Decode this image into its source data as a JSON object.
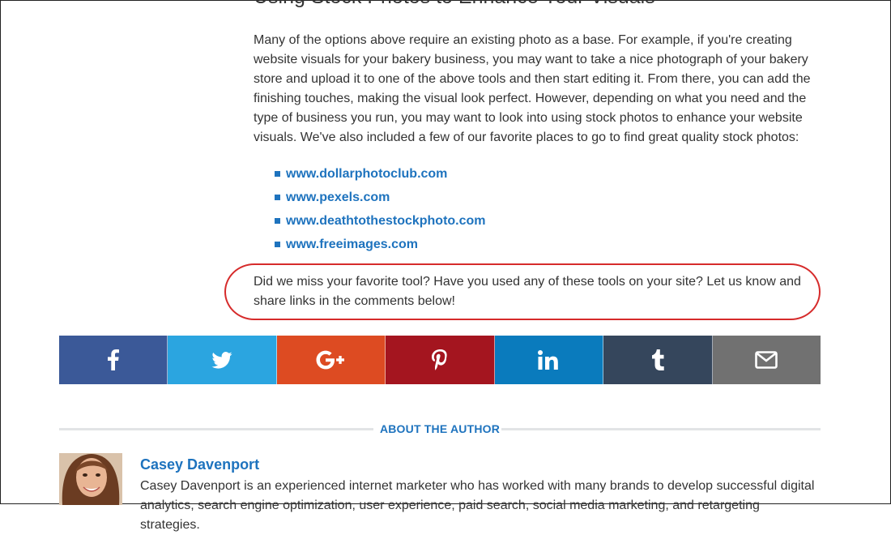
{
  "article": {
    "section_heading": "Using Stock Photos to Enhance Your Visuals",
    "paragraph": "Many of the options above require an existing photo as a base. For example, if you're creating website visuals for your bakery business, you may want to take a nice photograph of your bakery store and upload it to one of the above tools and then start editing it. From there, you can add the finishing touches, making the visual look perfect. However, depending on what you need and the type of business you run, you may want to look into using stock photos to enhance your website visuals. We've also included a few of our favorite places to go to find great quality stock photos:",
    "links": [
      {
        "label": "www.dollarphotoclub.com"
      },
      {
        "label": "www.pexels.com"
      },
      {
        "label": "www.deathtothestockphoto.com"
      },
      {
        "label": "www.freeimages.com"
      }
    ],
    "closing": "Did we miss your favorite tool? Have you used any of these tools on your site? Let us know and share links in the comments below!"
  },
  "share_bar": [
    {
      "network": "facebook",
      "icon": "facebook-icon",
      "color": "#3b5998"
    },
    {
      "network": "twitter",
      "icon": "twitter-icon",
      "color": "#2ba5e0"
    },
    {
      "network": "google-plus",
      "icon": "google-plus-icon",
      "color": "#dd4b22"
    },
    {
      "network": "pinterest",
      "icon": "pinterest-icon",
      "color": "#a4151f"
    },
    {
      "network": "linkedin",
      "icon": "linkedin-icon",
      "color": "#0a7bbd"
    },
    {
      "network": "tumblr",
      "icon": "tumblr-icon",
      "color": "#35465c"
    },
    {
      "network": "email",
      "icon": "envelope-icon",
      "color": "#717171"
    }
  ],
  "about": {
    "label": "ABOUT THE AUTHOR"
  },
  "author": {
    "name": "Casey Davenport",
    "bio": "Casey Davenport is an experienced internet marketer who has worked with many brands to develop successful digital analytics, search engine optimization, user experience, paid search, social media marketing, and retargeting strategies."
  },
  "colors": {
    "link": "#1e73be",
    "highlight": "#d62b2b",
    "divider": "#e2e4e6"
  }
}
